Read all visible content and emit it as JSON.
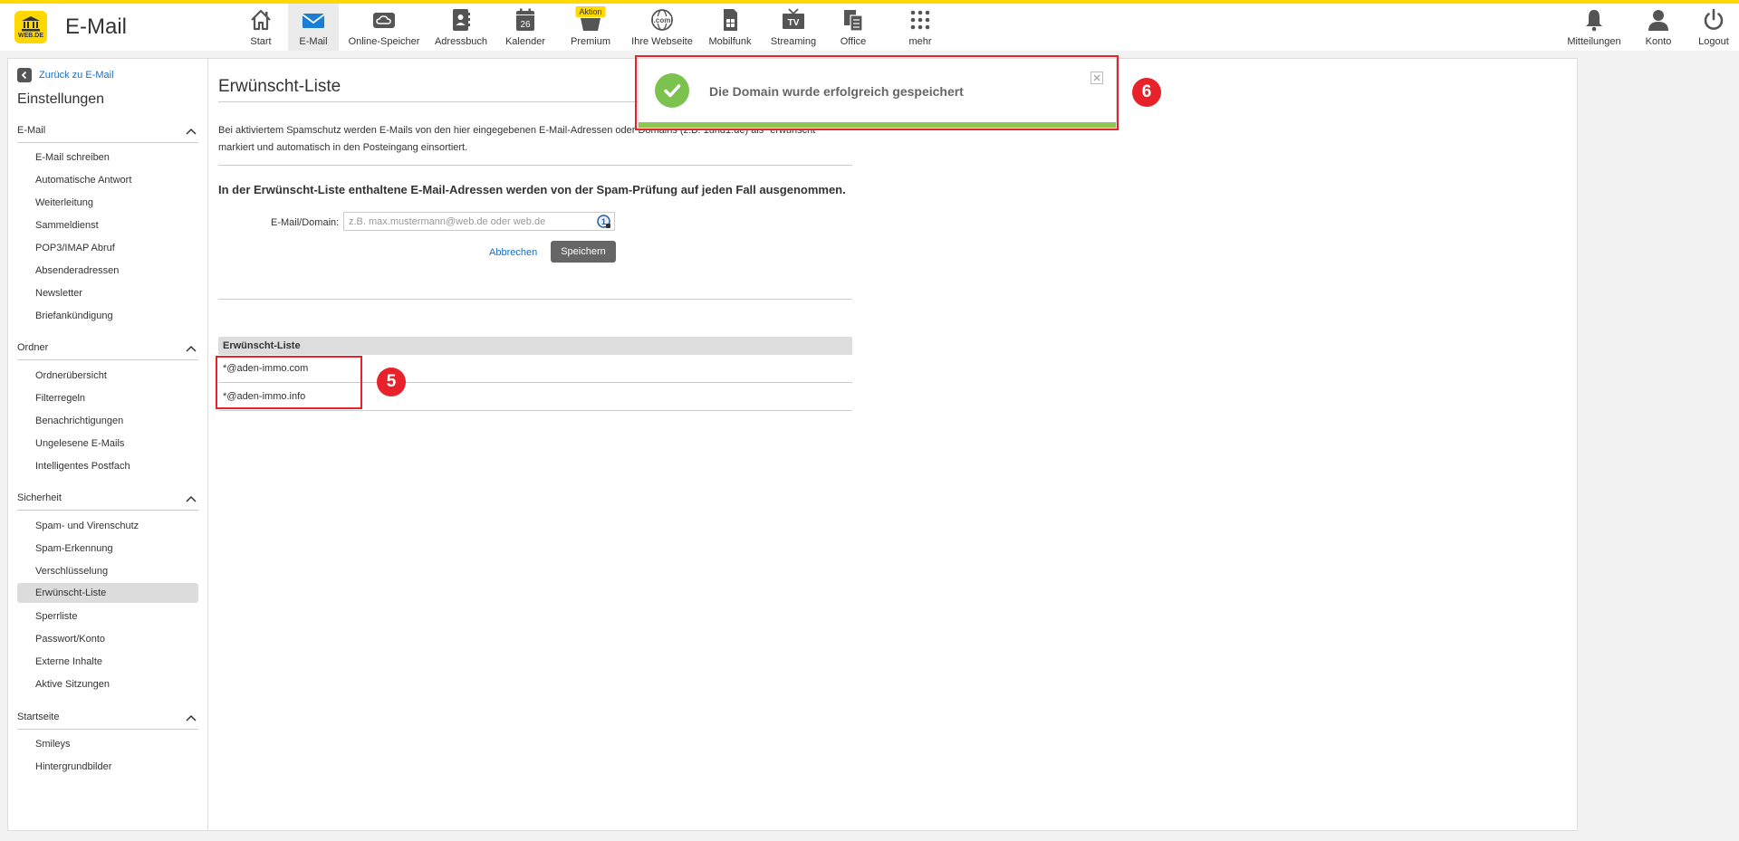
{
  "app": {
    "logo_text": "WEB.DE",
    "title": "E-Mail"
  },
  "nav": {
    "items": [
      {
        "label": "Start",
        "icon": "home-icon"
      },
      {
        "label": "E-Mail",
        "icon": "envelope-icon",
        "active": true
      },
      {
        "label": "Online-Speicher",
        "icon": "cloud-icon"
      },
      {
        "label": "Adressbuch",
        "icon": "address-book-icon"
      },
      {
        "label": "Kalender",
        "icon": "calendar-icon",
        "calendar_day": "26"
      },
      {
        "label": "Premium",
        "icon": "premium-icon",
        "badge": "Aktion"
      },
      {
        "label": "Ihre Webseite",
        "icon": "globe-com-icon",
        "icon_text": ".com"
      },
      {
        "label": "Mobilfunk",
        "icon": "sim-card-icon"
      },
      {
        "label": "Streaming",
        "icon": "tv-icon",
        "icon_text": "TV"
      },
      {
        "label": "Office",
        "icon": "office-icon"
      },
      {
        "label": "mehr",
        "icon": "grid-dots-icon"
      }
    ],
    "right_items": [
      {
        "label": "Mitteilungen",
        "icon": "bell-icon"
      },
      {
        "label": "Konto",
        "icon": "user-icon"
      },
      {
        "label": "Logout",
        "icon": "power-icon"
      }
    ]
  },
  "sidebar": {
    "back_label": "Zurück zu E-Mail",
    "title": "Einstellungen",
    "sections": [
      {
        "title": "E-Mail",
        "items": [
          "E-Mail schreiben",
          "Automatische Antwort",
          "Weiterleitung",
          "Sammeldienst",
          "POP3/IMAP Abruf",
          "Absenderadressen",
          "Newsletter",
          "Briefankündigung"
        ]
      },
      {
        "title": "Ordner",
        "items": [
          "Ordnerübersicht",
          "Filterregeln",
          "Benachrichtigungen",
          "Ungelesene E-Mails",
          "Intelligentes Postfach"
        ]
      },
      {
        "title": "Sicherheit",
        "items": [
          "Spam- und Virenschutz",
          "Spam-Erkennung",
          "Verschlüsselung",
          "Erwünscht-Liste",
          "Sperrliste",
          "Passwort/Konto",
          "Externe Inhalte",
          "Aktive Sitzungen"
        ],
        "active_item": "Erwünscht-Liste"
      },
      {
        "title": "Startseite",
        "items": [
          "Smileys",
          "Hintergrundbilder"
        ]
      }
    ]
  },
  "main": {
    "title": "Erwünscht-Liste",
    "intro": "Bei aktiviertem Spamschutz werden E-Mails von den hier eingegebenen E-Mail-Adressen oder Domains (z.B. 1und1.de) als \"erwünscht\" markiert und automatisch in den Posteingang einsortiert.",
    "notice": "In der Erwünscht-Liste enthaltene E-Mail-Adressen werden von der Spam-Prüfung auf jeden Fall ausgenommen.",
    "field_label": "E-Mail/Domain:",
    "field_placeholder": "z.B. max.mustermann@web.de oder web.de",
    "field_value": "",
    "cancel_label": "Abbrechen",
    "save_label": "Speichern",
    "list_header": "Erwünscht-Liste",
    "list_items": [
      "*@aden-immo.com",
      "*@aden-immo.info"
    ]
  },
  "toast": {
    "message": "Die Domain wurde erfolgreich gespeichert",
    "progress": 1.0
  },
  "annotations": {
    "badge_list": "5",
    "badge_toast": "6"
  },
  "colors": {
    "brand_yellow": "#ffd800",
    "link_blue": "#1a6fbf",
    "success_green": "#7cc24f",
    "annotation_red": "#e8222a"
  }
}
